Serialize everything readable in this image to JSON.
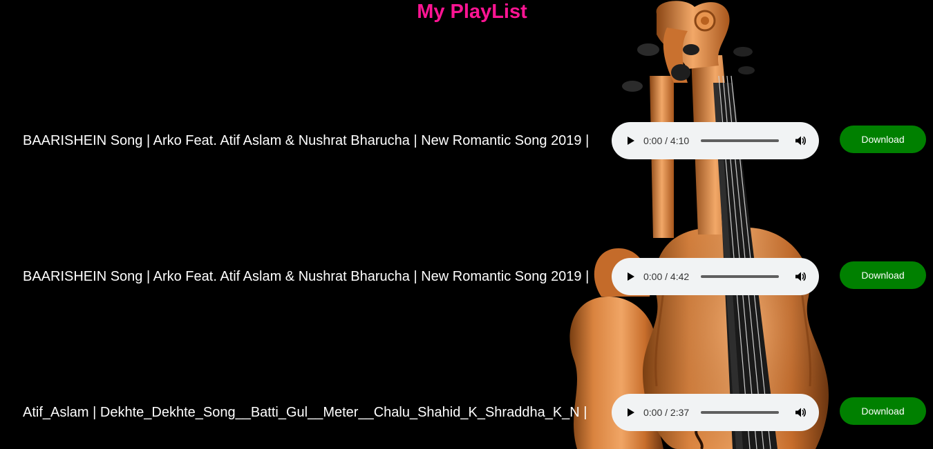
{
  "page": {
    "title": "My PlayList"
  },
  "songs": [
    {
      "title": "BAARISHEIN Song | Arko Feat. Atif Aslam & Nushrat Bharucha | New Romantic Song 2019 |",
      "time": "0:00 / 4:10",
      "download_label": "Download"
    },
    {
      "title": "BAARISHEIN Song | Arko Feat. Atif Aslam & Nushrat Bharucha | New Romantic Song 2019 |",
      "time": "0:00 / 4:42",
      "download_label": "Download"
    },
    {
      "title": "Atif_Aslam | Dekhte_Dekhte_Song__Batti_Gul__Meter__Chalu_Shahid_K_Shraddha_K_N |",
      "time": "0:00 / 2:37",
      "download_label": "Download"
    }
  ],
  "colors": {
    "background": "#000000",
    "title": "#ff1493",
    "download_button": "#008000",
    "player_background": "#f1f3f4"
  },
  "icons": {
    "play": "play-icon",
    "volume": "volume-icon"
  }
}
